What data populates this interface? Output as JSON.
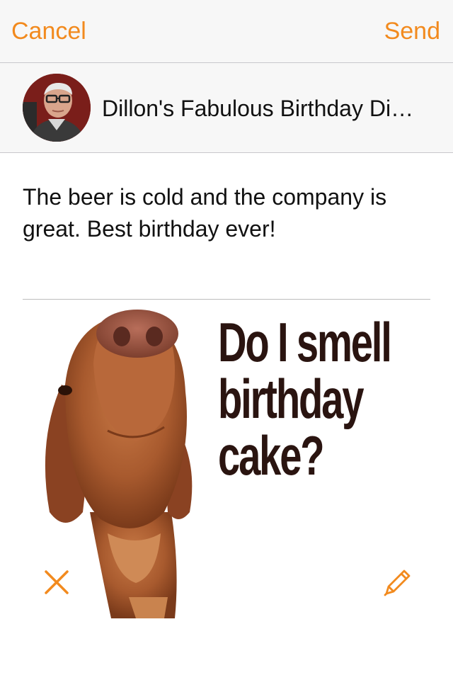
{
  "nav": {
    "cancel_label": "Cancel",
    "send_label": "Send"
  },
  "event": {
    "title": "Dillon's Fabulous Birthday Di…"
  },
  "post": {
    "message": "The beer is cold and the company is great. Best birthday ever!"
  },
  "photo": {
    "caption_lines": [
      "Do I smell",
      "birthday",
      "cake?"
    ]
  },
  "icons": {
    "remove": "close-icon",
    "edit": "pencil-icon"
  },
  "colors": {
    "accent": "#f28a1e",
    "text": "#111111",
    "bar_background": "#f7f7f7"
  }
}
